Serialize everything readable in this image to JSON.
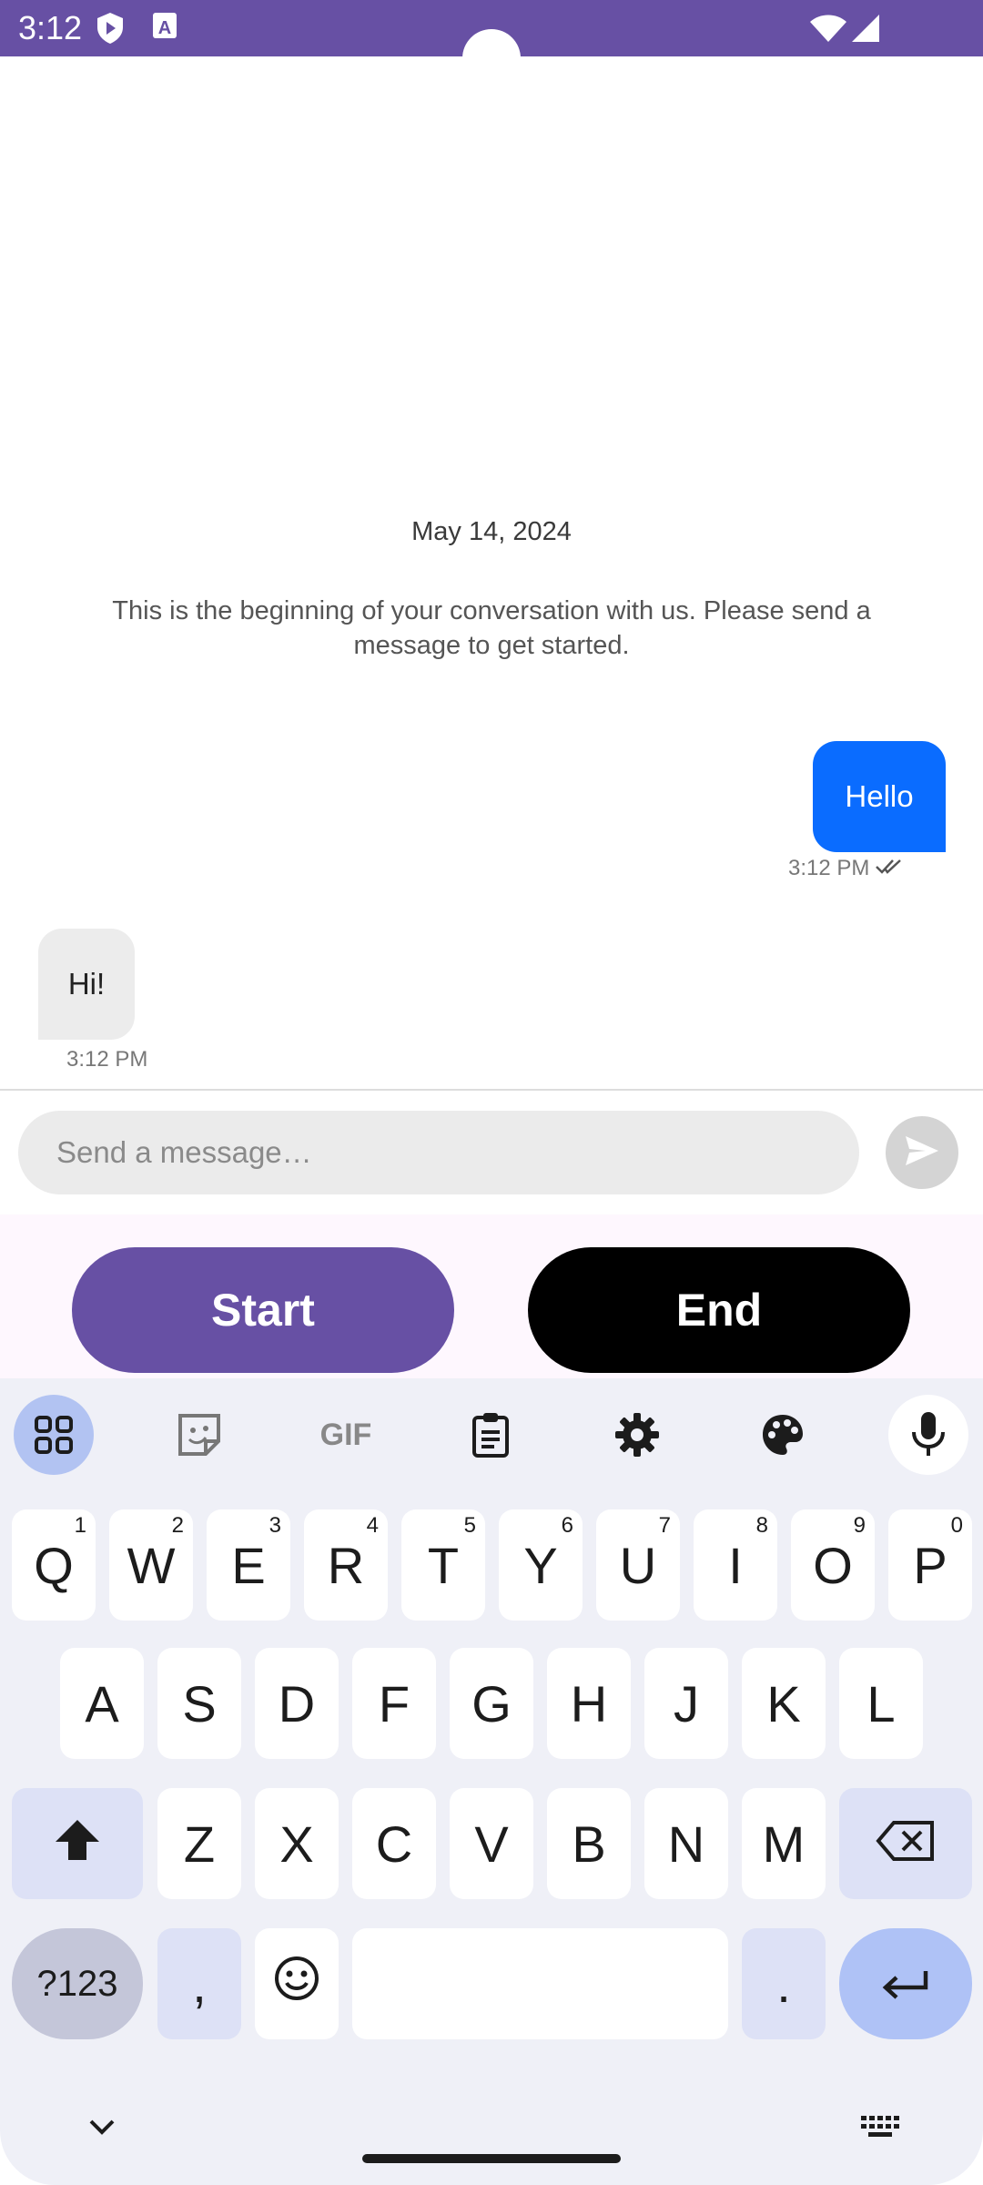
{
  "status_bar": {
    "time": "3:12",
    "icons": [
      "shield-play-icon",
      "text-a-icon",
      "wifi-icon",
      "signal-icon"
    ]
  },
  "conversation": {
    "date": "May 14, 2024",
    "intro": "This is the beginning of your conversation with us. Please send a message to get started.",
    "messages": [
      {
        "direction": "outgoing",
        "text": "Hello",
        "time": "3:12 PM",
        "status_icon": "double-check-icon"
      },
      {
        "direction": "incoming",
        "text": "Hi!",
        "time": "3:12 PM"
      }
    ]
  },
  "composer": {
    "placeholder": "Send a message…",
    "value": "",
    "send_icon": "send-icon"
  },
  "actions": {
    "start_label": "Start",
    "end_label": "End",
    "start_color": "#6750a4",
    "end_color": "#000000"
  },
  "keyboard": {
    "toolbar": [
      "apps-grid-icon",
      "sticker-icon",
      "gif-icon",
      "clipboard-icon",
      "settings-icon",
      "palette-icon",
      "mic-icon"
    ],
    "gif_label": "GIF",
    "row1": [
      "Q",
      "W",
      "E",
      "R",
      "T",
      "Y",
      "U",
      "I",
      "O",
      "P"
    ],
    "row1_hints": [
      "1",
      "2",
      "3",
      "4",
      "5",
      "6",
      "7",
      "8",
      "9",
      "0"
    ],
    "row2": [
      "A",
      "S",
      "D",
      "F",
      "G",
      "H",
      "J",
      "K",
      "L"
    ],
    "row3": [
      "Z",
      "X",
      "C",
      "V",
      "B",
      "N",
      "M"
    ],
    "symbols_label": "?123",
    "comma": ",",
    "period": "."
  },
  "colors": {
    "accent": "#6750a4",
    "outgoing_bubble": "#0a6cff",
    "incoming_bubble": "#ececec",
    "keyboard_bg": "#eff0f7"
  }
}
